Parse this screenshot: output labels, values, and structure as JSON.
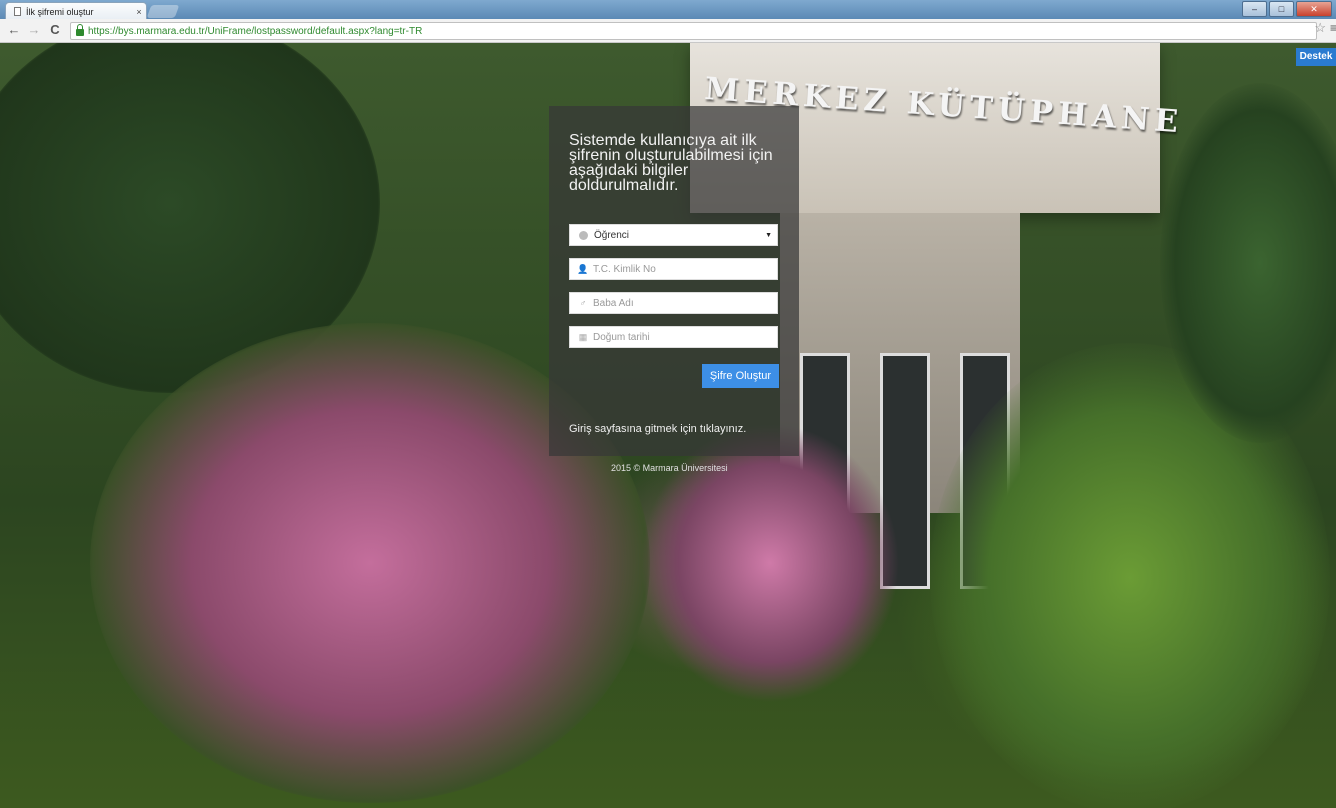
{
  "browser": {
    "tab_title": "İlk şifremi oluştur",
    "tab_close": "×",
    "url": "https://bys.marmara.edu.tr/UniFrame/lostpassword/default.aspx?lang=tr-TR",
    "star": "☆",
    "menu": "≡",
    "nav": {
      "back": "←",
      "forward": "→",
      "reload": "C"
    },
    "window_buttons": {
      "minimize": "–",
      "maximize": "□",
      "close": "✕"
    }
  },
  "page": {
    "building_sign": "MERKEZ KÜTÜPHANE",
    "support_button": "Destek",
    "panel": {
      "title": "Sistemde kullanıcıya ait ilk şifrenin oluşturulabilmesi için aşağıdaki bilgiler doldurulmalıdır.",
      "user_type": {
        "selected": "Öğrenci",
        "caret": "▼"
      },
      "fields": {
        "tc_kimlik": {
          "placeholder": "T.C. Kimlik No",
          "icon": "user-icon"
        },
        "baba_adi": {
          "placeholder": "Baba Adı",
          "icon": "male-icon"
        },
        "dogum_tarihi": {
          "placeholder": "Doğum tarihi",
          "icon": "calendar-icon"
        }
      },
      "submit_label": "Şifre Oluştur",
      "back_link": "Giriş sayfasına gitmek için tıklayınız."
    },
    "footer": "2015 © Marmara Üniversitesi"
  }
}
